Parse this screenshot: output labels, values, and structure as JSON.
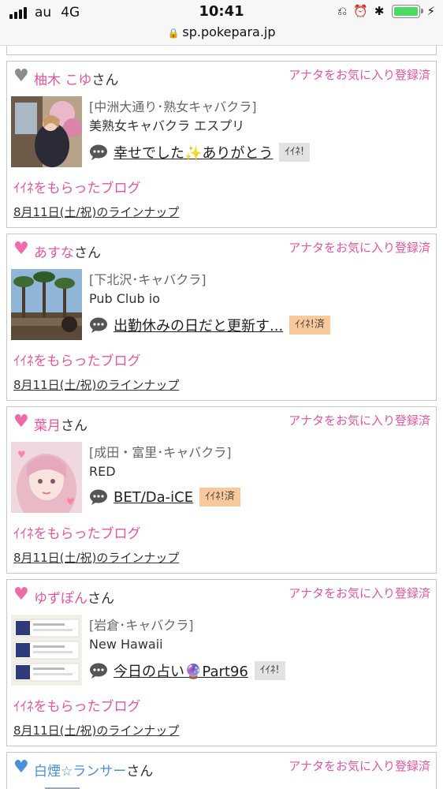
{
  "status_bar": {
    "carrier": "au",
    "network": "4G",
    "time": "10:41",
    "url": "sp.pokepara.jp",
    "battery_level": 1.0
  },
  "colors": {
    "accent_pink": "#e8559e",
    "heart_gray": "#8c8c8c",
    "heart_pink": "#f06aa9",
    "heart_blue": "#4a90d9",
    "iine_done_bg": "#f9c99b",
    "iine_gray_bg": "#e2e2e2"
  },
  "cards": [
    {
      "heart": "gray-heart-icon",
      "name": "柚木 こゆ",
      "suffix": "さん",
      "fav_status": "アナタをお気に入り登録済",
      "area": "[中洲大通り･熟女キャバクラ]",
      "shop": "美熟女キャバクラ エスプリ",
      "blog_title": "幸せでした✨ありがとう",
      "iine_label": "ｲｲﾈ!",
      "iine_state": "gray",
      "got_link": "ｲｲﾈをもらったブログ",
      "lineup": "8月11日(土/祝)のラインナップ"
    },
    {
      "heart": "pink-heart-icon",
      "name": "あすな",
      "suffix": "さん",
      "fav_status": "アナタをお気に入り登録済",
      "area": "[下北沢･キャバクラ]",
      "shop": "Pub Club io",
      "blog_title": "出勤休みの日だと更新す...",
      "iine_label": "ｲｲﾈ!済",
      "iine_state": "done",
      "got_link": "ｲｲﾈをもらったブログ",
      "lineup": "8月11日(土/祝)のラインナップ"
    },
    {
      "heart": "pink-heart-icon",
      "name": "葉月",
      "suffix": "さん",
      "fav_status": "アナタをお気に入り登録済",
      "area": "[成田・富里･キャバクラ]",
      "shop": "RED",
      "blog_title": "BET/Da-iCE",
      "iine_label": "ｲｲﾈ!済",
      "iine_state": "done",
      "got_link": "ｲｲﾈをもらったブログ",
      "lineup": "8月11日(土/祝)のラインナップ"
    },
    {
      "heart": "pink-heart-icon",
      "name": "ゆずぽん",
      "suffix": "さん",
      "fav_status": "アナタをお気に入り登録済",
      "area": "[岩倉･キャバクラ]",
      "shop": "New Hawaii",
      "blog_title": "今日の占い🔮Part96",
      "iine_label": "ｲｲﾈ!",
      "iine_state": "gray",
      "got_link": "ｲｲﾈをもらったブログ",
      "lineup": "8月11日(土/祝)のラインナップ"
    },
    {
      "heart": "blue-heart-icon",
      "name": "白煙☆ランサー",
      "suffix": "さん",
      "fav_status": "アナタをお気に入り登録済"
    }
  ]
}
